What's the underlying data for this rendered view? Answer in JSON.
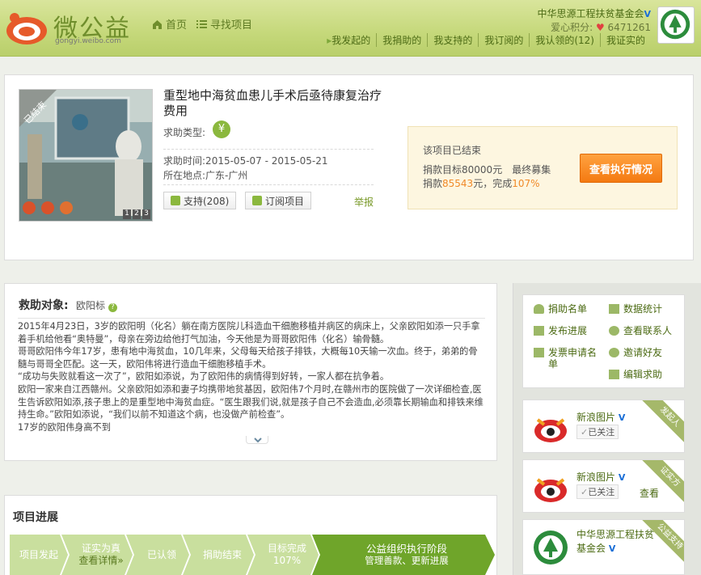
{
  "header": {
    "logo_name": "微公益",
    "logo_url": "gongyi.weibo.com",
    "nav": [
      {
        "label": "首页",
        "icon": "home-icon"
      },
      {
        "label": "寻找项目",
        "icon": "list-icon"
      }
    ],
    "org_name": "中华思源工程扶贫基金会",
    "love_label": "爱心积分:",
    "love_value": "6471261",
    "subnav": [
      "我发起的",
      "我捐助的",
      "我支持的",
      "我订阅的",
      "我认领的(12)",
      "我证实的"
    ]
  },
  "project": {
    "photo_badge": "已结束",
    "photo_pages": [
      "1",
      "2",
      "3"
    ],
    "title": "重型地中海贫血患儿手术后亟待康复治疗费用",
    "type_label": "求助类型:",
    "type_icon": "yuan-icon",
    "time_label": "求助时间",
    "time_value": ":2015-05-07 - 2015-05-21",
    "place_label": "所在地点",
    "place_value": ":广东-广州",
    "support_button": "支持(208)",
    "subscribe_button": "订阅项目",
    "report_link": "举报"
  },
  "status": {
    "title": "该项目已结束",
    "target_label": "捐款目标",
    "target_value": "80000元",
    "final_label": "最终募集",
    "donated_label": "捐款",
    "donated_value": "85543",
    "donated_unit": "元，完成",
    "percent": "107%",
    "exec_button": "查看执行情况"
  },
  "story": {
    "heading": "救助对象:",
    "name": "欧阳标",
    "paragraphs": [
      "2015年4月23日，3岁的欧阳明（化名）躺在南方医院儿科造血干细胞移植并病区的病床上，父亲欧阳如添一只手拿着手机给他看“奥特曼”，母亲在旁边给他打气加油，今天他是为哥哥欧阳伟（化名）输骨髓。",
      "哥哥欧阳伟今年17岁，患有地中海贫血，10几年来，父母每天给孩子排铁，大概每10天输一次血。终于，弟弟的骨髓与哥哥全匹配。这一天，欧阳伟将进行造血干细胞移植手术。",
      "“成功与失败就看这一次了”，欧阳如添说，为了欧阳伟的病情得到好转，一家人都在抗争着。",
      "欧阳一家来自江西赣州。父亲欧阳如添和妻子均携带地贫基因，欧阳伟7个月时,在赣州市的医院做了一次详细检查,医生告诉欧阳如添,孩子患上的是重型地中海贫血症。“医生跟我们说,就是孩子自己不会造血,必须靠长期输血和排铁来维持生命。”欧阳如添说，“我们以前不知道这个病，也没做产前检查”。",
      "17岁的欧阳伟身高不到"
    ]
  },
  "progress": {
    "title": "项目进展",
    "steps": [
      {
        "line1": "项目发起",
        "line2": ""
      },
      {
        "line1": "证实为真",
        "line2": "查看详情»"
      },
      {
        "line1": "已认领",
        "line2": ""
      },
      {
        "line1": "捐助结束",
        "line2": ""
      },
      {
        "line1": "目标完成",
        "line2": "107%"
      },
      {
        "line1": "公益组织执行阶段",
        "line2": "管理善款、更新进展"
      }
    ]
  },
  "sidebar": {
    "menu": [
      {
        "label": "捐助名单",
        "icon": "donor-list-icon"
      },
      {
        "label": "数据统计",
        "icon": "stats-icon"
      },
      {
        "label": "发布进展",
        "icon": "publish-icon"
      },
      {
        "label": "查看联系人",
        "icon": "contact-icon"
      },
      {
        "label": "发票申请名单",
        "icon": "invoice-icon"
      },
      {
        "label": "邀请好友",
        "icon": "invite-icon"
      },
      {
        "label": "编辑求助",
        "icon": "edit-icon"
      }
    ],
    "people": [
      {
        "name": "新浪图片",
        "follow": "已关注",
        "extra": "",
        "ribbon": "发起人"
      },
      {
        "name": "新浪图片",
        "follow": "已关注",
        "extra": "查看",
        "ribbon": "证实方"
      },
      {
        "name": "中华思源工程扶贫基金会",
        "follow": "",
        "extra": "",
        "ribbon": "公益支持"
      }
    ]
  },
  "colors": {
    "brand_green": "#7ea83a",
    "accent_orange": "#f47a12",
    "header_bg": "#c5d87a"
  }
}
